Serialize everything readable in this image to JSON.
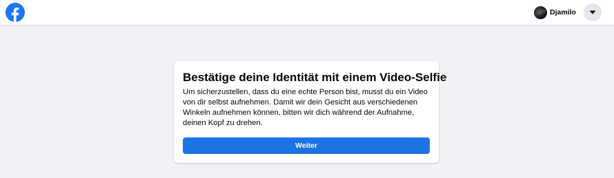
{
  "header": {
    "logo_icon": "facebook-logo-icon",
    "profile": {
      "name": "Djamilo",
      "avatar_icon": "profile-avatar"
    },
    "menu_icon": "caret-down-icon"
  },
  "card": {
    "title": "Bestätige deine Identität mit einem Video-Selfie",
    "body": "Um sicherzustellen, dass du eine echte Person bist, musst du ein Video von dir selbst aufnehmen. Damit wir dein Gesicht aus verschiedenen Winkeln aufnehmen können, bitten wir dich während der Aufnahme, deinen Kopf zu drehen.",
    "primary_button_label": "Weiter"
  },
  "colors": {
    "brand_blue": "#1877f2",
    "button_blue": "#1b74e4",
    "page_background": "#f0f2f5",
    "menu_button_gray": "#e4e6eb"
  }
}
